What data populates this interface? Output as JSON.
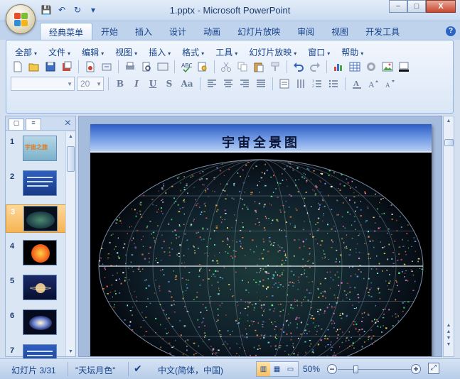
{
  "window": {
    "title": "1.pptx - Microsoft PowerPoint",
    "controls": {
      "minimize": "−",
      "maximize": "□",
      "close": "X"
    }
  },
  "quick_access": [
    {
      "name": "save-icon",
      "glyph": "💾"
    },
    {
      "name": "undo-icon",
      "glyph": "↶"
    },
    {
      "name": "redo-icon",
      "glyph": "↻"
    },
    {
      "name": "customize-icon",
      "glyph": "▾"
    }
  ],
  "tabs": [
    "经典菜单",
    "开始",
    "插入",
    "设计",
    "动画",
    "幻灯片放映",
    "审阅",
    "视图",
    "开发工具"
  ],
  "active_tab_index": 0,
  "help": "?",
  "menus": [
    "全部",
    "文件",
    "编辑",
    "视图",
    "插入",
    "格式",
    "工具",
    "幻灯片放映",
    "窗口",
    "帮助"
  ],
  "toolbar": {
    "font_name": "",
    "font_size": "20",
    "format_buttons": [
      "B",
      "I",
      "U",
      "S",
      "Aa"
    ]
  },
  "slides": [
    {
      "number": "1",
      "kind": "title",
      "label": "宇宙之旅"
    },
    {
      "number": "2",
      "kind": "blue-text"
    },
    {
      "number": "3",
      "kind": "skymap"
    },
    {
      "number": "4",
      "kind": "sun"
    },
    {
      "number": "5",
      "kind": "saturn"
    },
    {
      "number": "6",
      "kind": "galaxy"
    },
    {
      "number": "7",
      "kind": "blue-text"
    }
  ],
  "selected_slide": 3,
  "current_slide": {
    "title": "宇宙全景图"
  },
  "statusbar": {
    "slide_info": "幻灯片 3/31",
    "theme": "\"天坛月色\"",
    "language": "中文(简体，中国)",
    "zoom": "50%"
  },
  "colors": {
    "ribbon_bg": "#dbe7f6",
    "selected_thumb": "#f6b454",
    "slide_title_bar": "#2c5cc4"
  }
}
